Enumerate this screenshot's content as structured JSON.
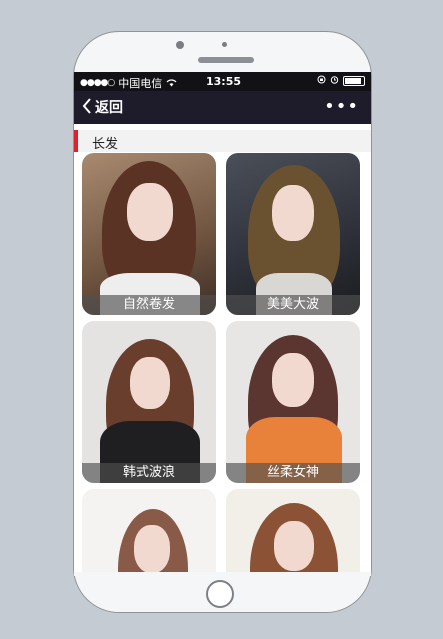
{
  "status": {
    "carrier": "中国电信",
    "time": "13:55"
  },
  "nav": {
    "back_label": "返回",
    "more_label": "•••"
  },
  "section": {
    "title": "长发"
  },
  "cards": [
    {
      "caption": "自然卷发"
    },
    {
      "caption": "美美大波"
    },
    {
      "caption": "韩式波浪"
    },
    {
      "caption": "丝柔女神"
    },
    {
      "caption": ""
    },
    {
      "caption": ""
    }
  ],
  "colors": {
    "accent": "#e0212b",
    "navbar": "#1e1b2a",
    "statusbar": "#121216"
  }
}
